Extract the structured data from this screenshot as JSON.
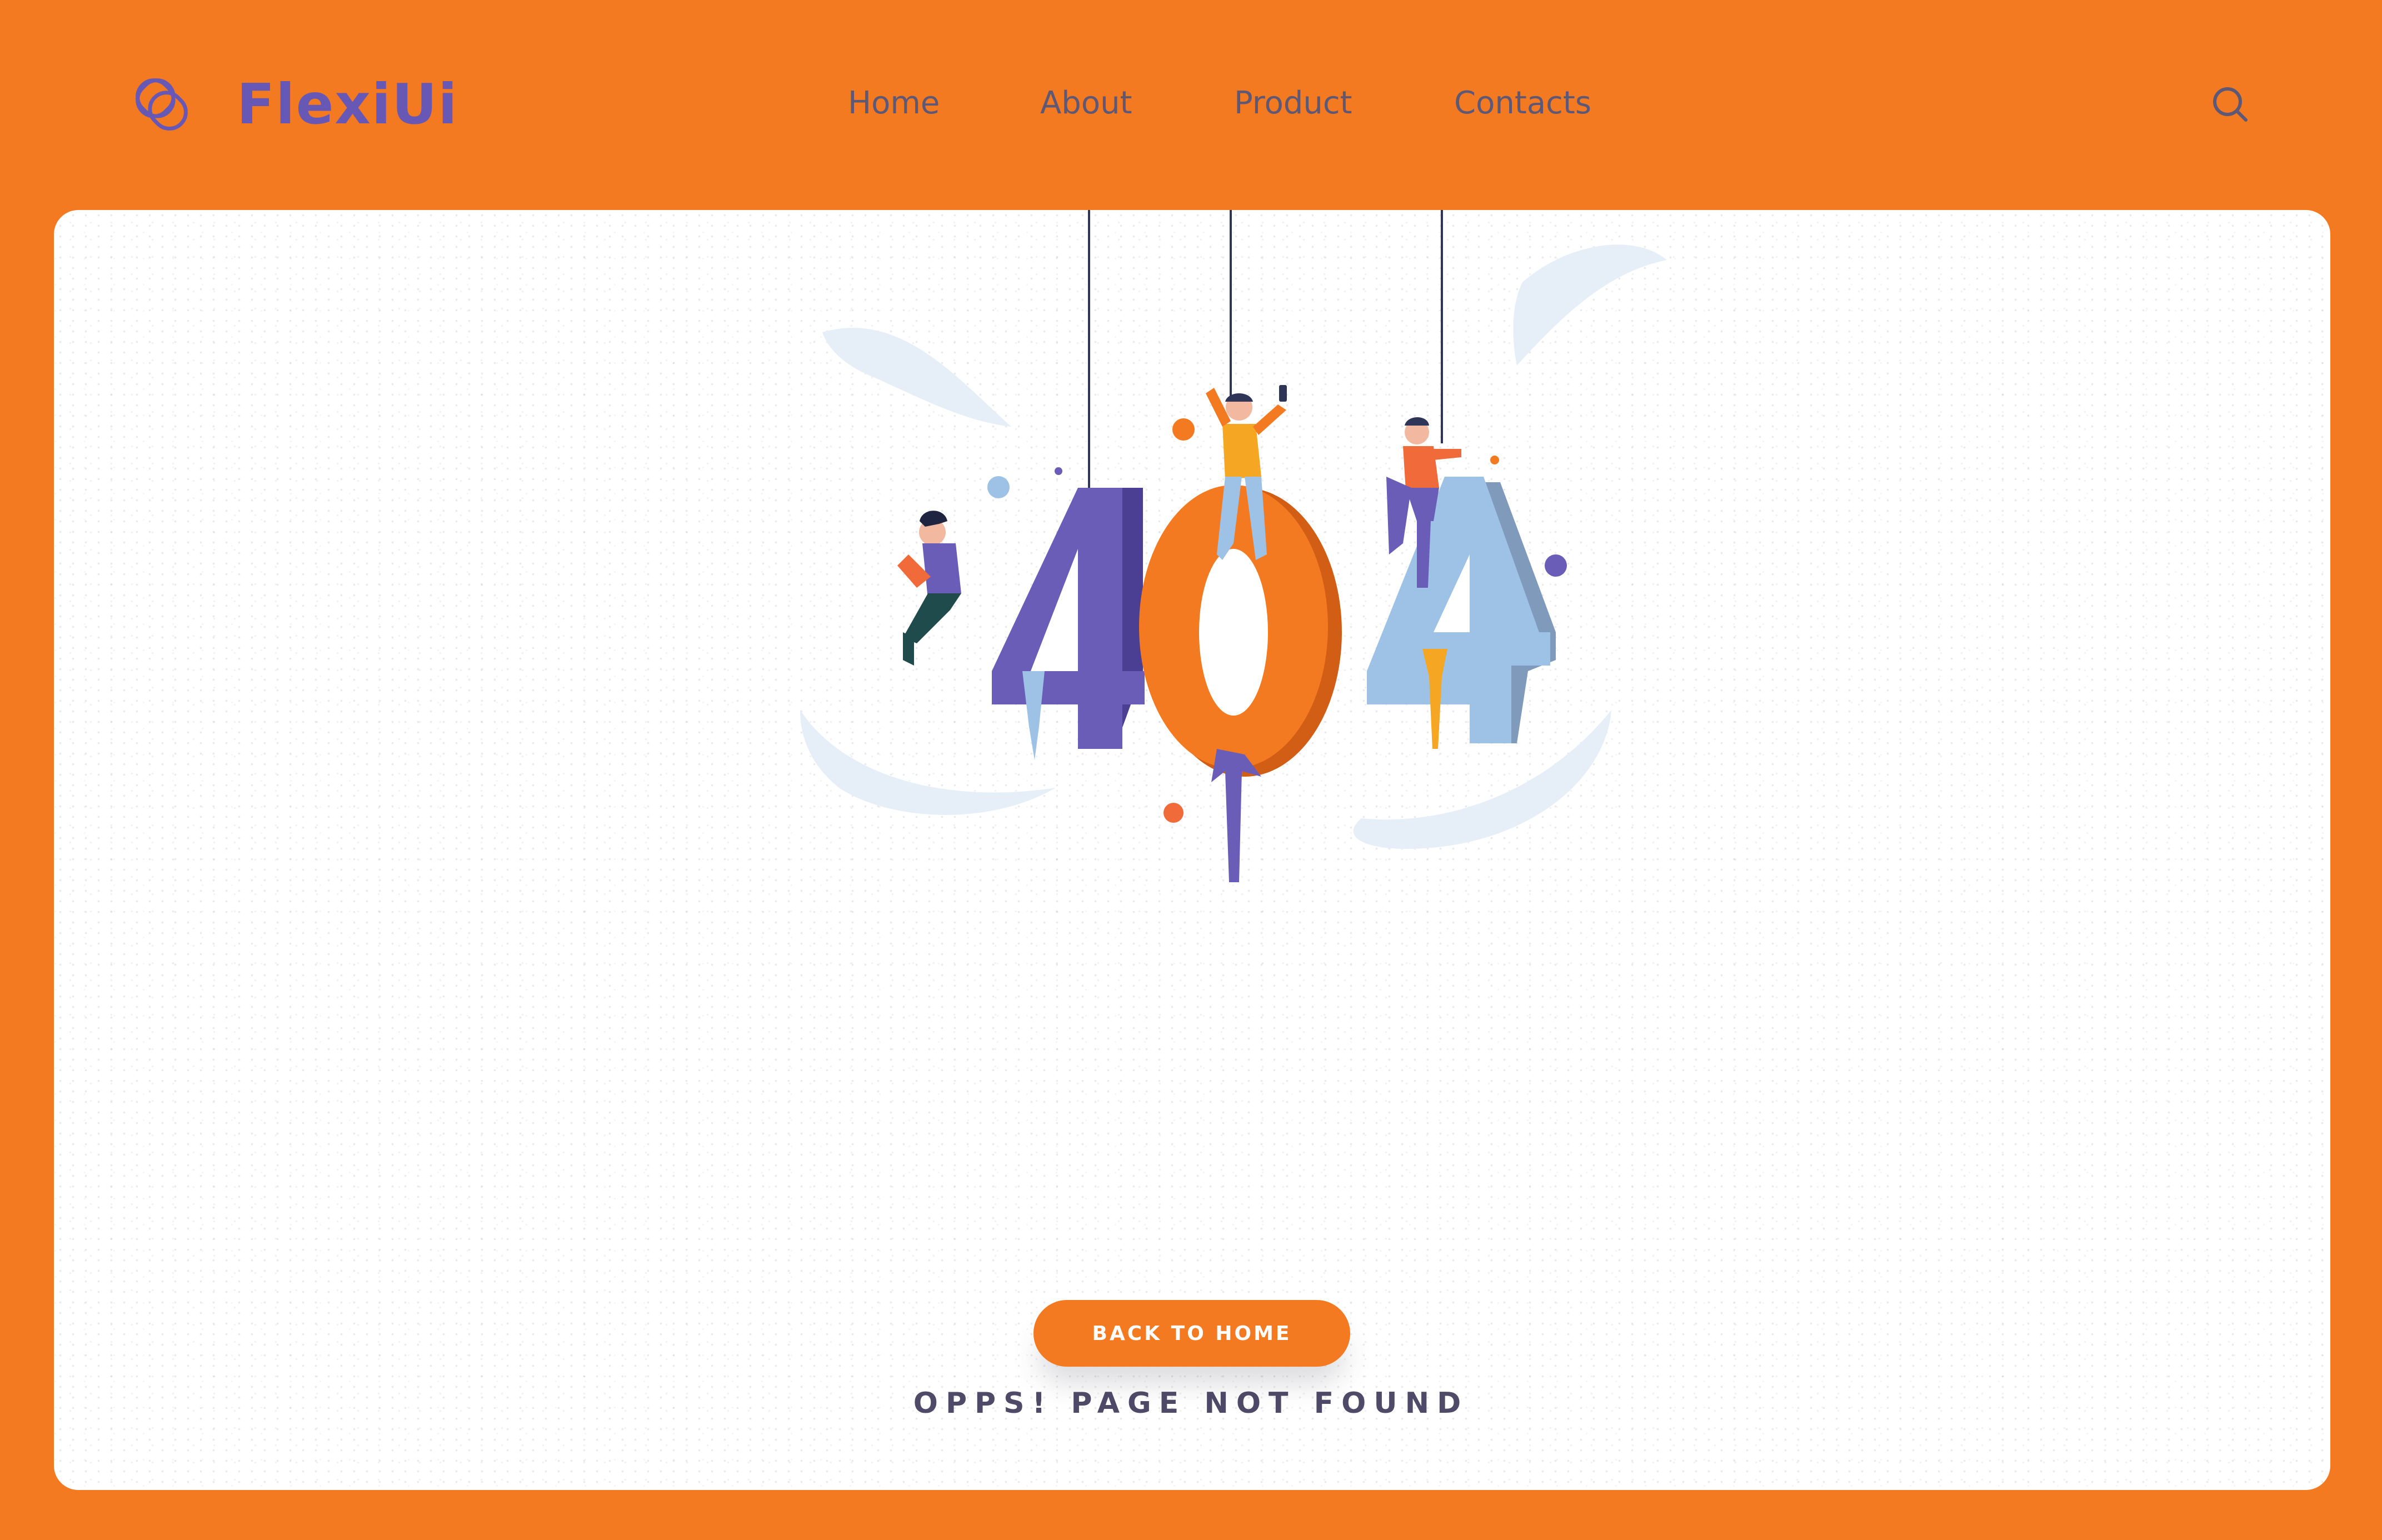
{
  "header": {
    "brand": "FlexiUi",
    "nav": [
      {
        "label": "Home"
      },
      {
        "label": "About"
      },
      {
        "label": "Product"
      },
      {
        "label": "Contacts"
      }
    ],
    "search_icon": "search-icon"
  },
  "main": {
    "illustration_digits": [
      "4",
      "0",
      "4"
    ],
    "message": "OPPS! PAGE NOT FOUND",
    "button_label": "BACK TO HOME"
  },
  "colors": {
    "background": "#F47A21",
    "card": "#FFFFFF",
    "brand_purple": "#6658B4",
    "nav_text": "#5E5877",
    "message_text": "#4F4A68",
    "digit_purple": "#6A5DB8",
    "digit_orange": "#F47A21",
    "digit_blue": "#9EC2E6"
  }
}
